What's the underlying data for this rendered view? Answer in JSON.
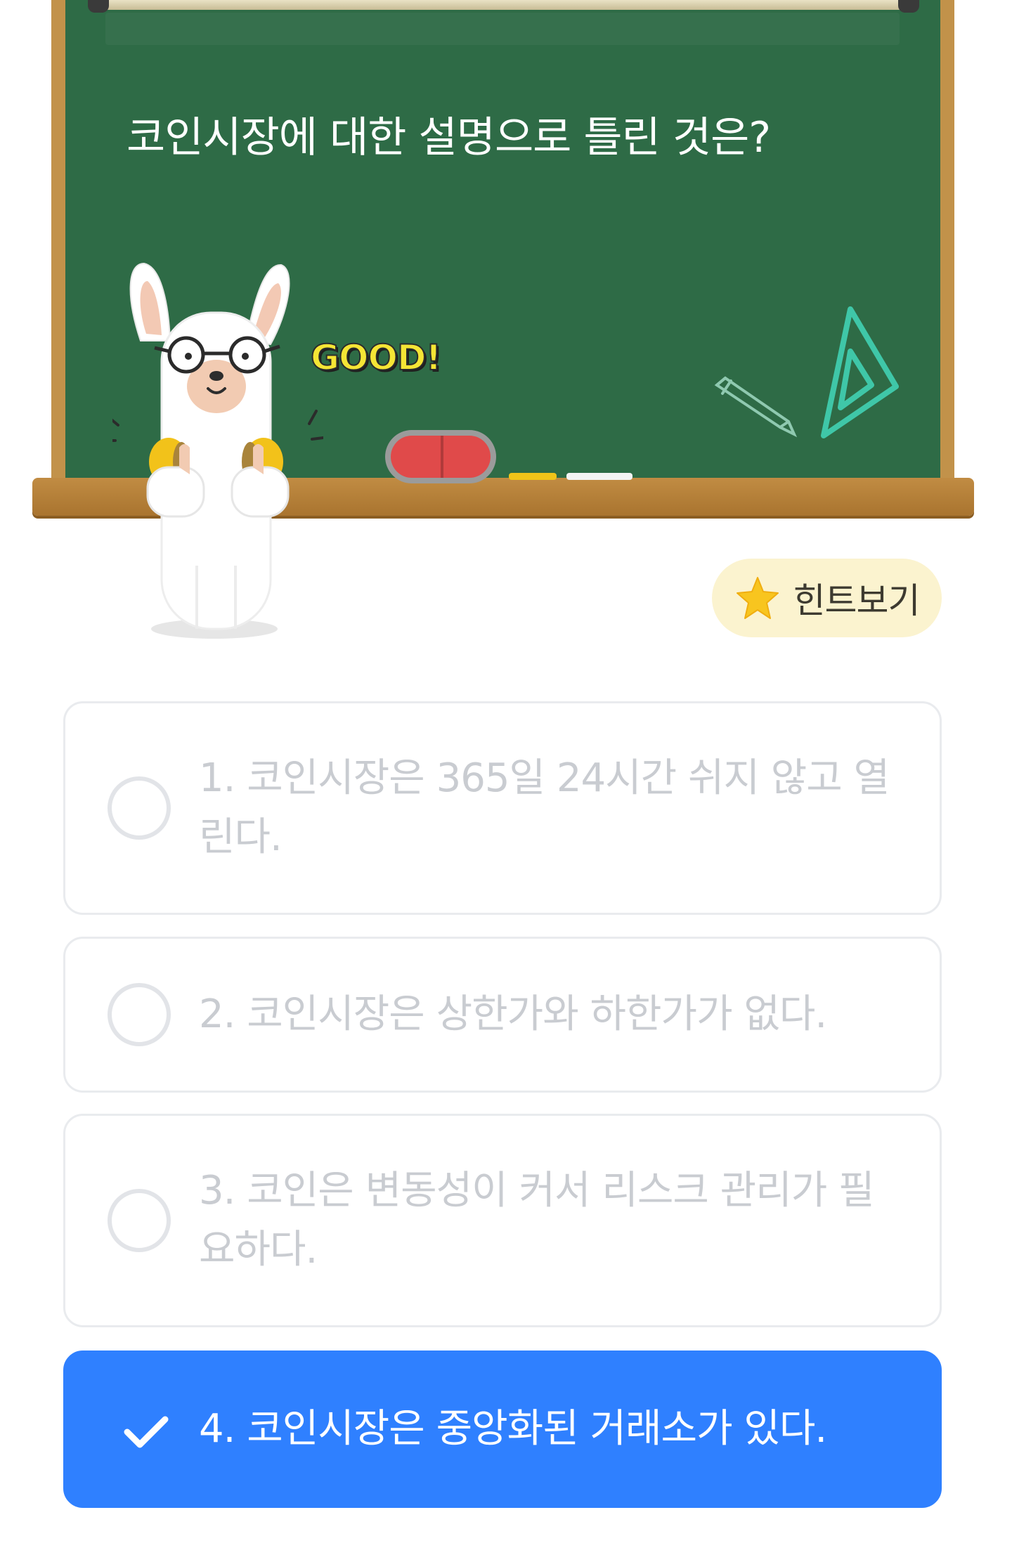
{
  "quiz": {
    "question": "코인시장에 대한 설명으로 틀린 것은?",
    "badge": "GOOD!"
  },
  "hint": {
    "label": "힌트보기",
    "icon": "star-icon"
  },
  "options": [
    {
      "text": "1. 코인시장은 365일 24시간 쉬지 않고 열린다.",
      "selected": false
    },
    {
      "text": "2. 코인시장은 상한가와 하한가가 없다.",
      "selected": false
    },
    {
      "text": "3. 코인은 변동성이 커서 리스크 관리가 필요하다.",
      "selected": false
    },
    {
      "text": "4. 코인시장은 중앙화된 거래소가 있다.",
      "selected": true
    }
  ],
  "colors": {
    "board": "#2e6b46",
    "frame": "#c2924a",
    "accent": "#2f80ff",
    "hint_bg": "#fbf3cf",
    "option_text_muted": "#c9ccd1"
  }
}
